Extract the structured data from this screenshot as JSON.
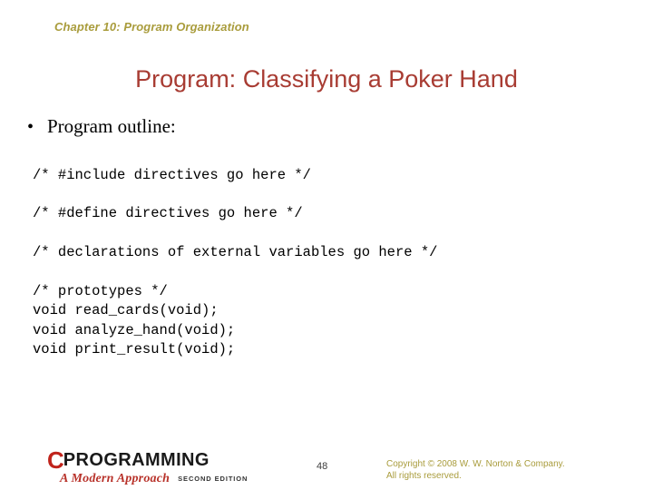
{
  "slide": {
    "chapter_header": "Chapter 10: Program Organization",
    "title": "Program: Classifying a Poker Hand",
    "bullet": {
      "marker": "•",
      "text": "Program outline:"
    },
    "code_blocks": [
      "/* #include directives go here */",
      "/* #define directives go here */",
      "/* declarations of external variables go here */",
      "/* prototypes */\nvoid read_cards(void);\nvoid analyze_hand(void);\nvoid print_result(void);"
    ]
  },
  "footer": {
    "logo": {
      "letter_c": "C",
      "word": "PROGRAMMING",
      "subtitle": "A Modern Approach",
      "edition": "SECOND EDITION"
    },
    "page_number": "48",
    "copyright_line1": "Copyright © 2008 W. W. Norton & Company.",
    "copyright_line2": "All rights reserved."
  },
  "colors": {
    "background": "#ffffff",
    "chapter_header": "#a99c3c",
    "title": "#a83c33",
    "body_text": "#000000",
    "logo_red": "#c0241c",
    "logo_subtitle_red": "#b8322a",
    "copyright": "#a99c3c"
  }
}
